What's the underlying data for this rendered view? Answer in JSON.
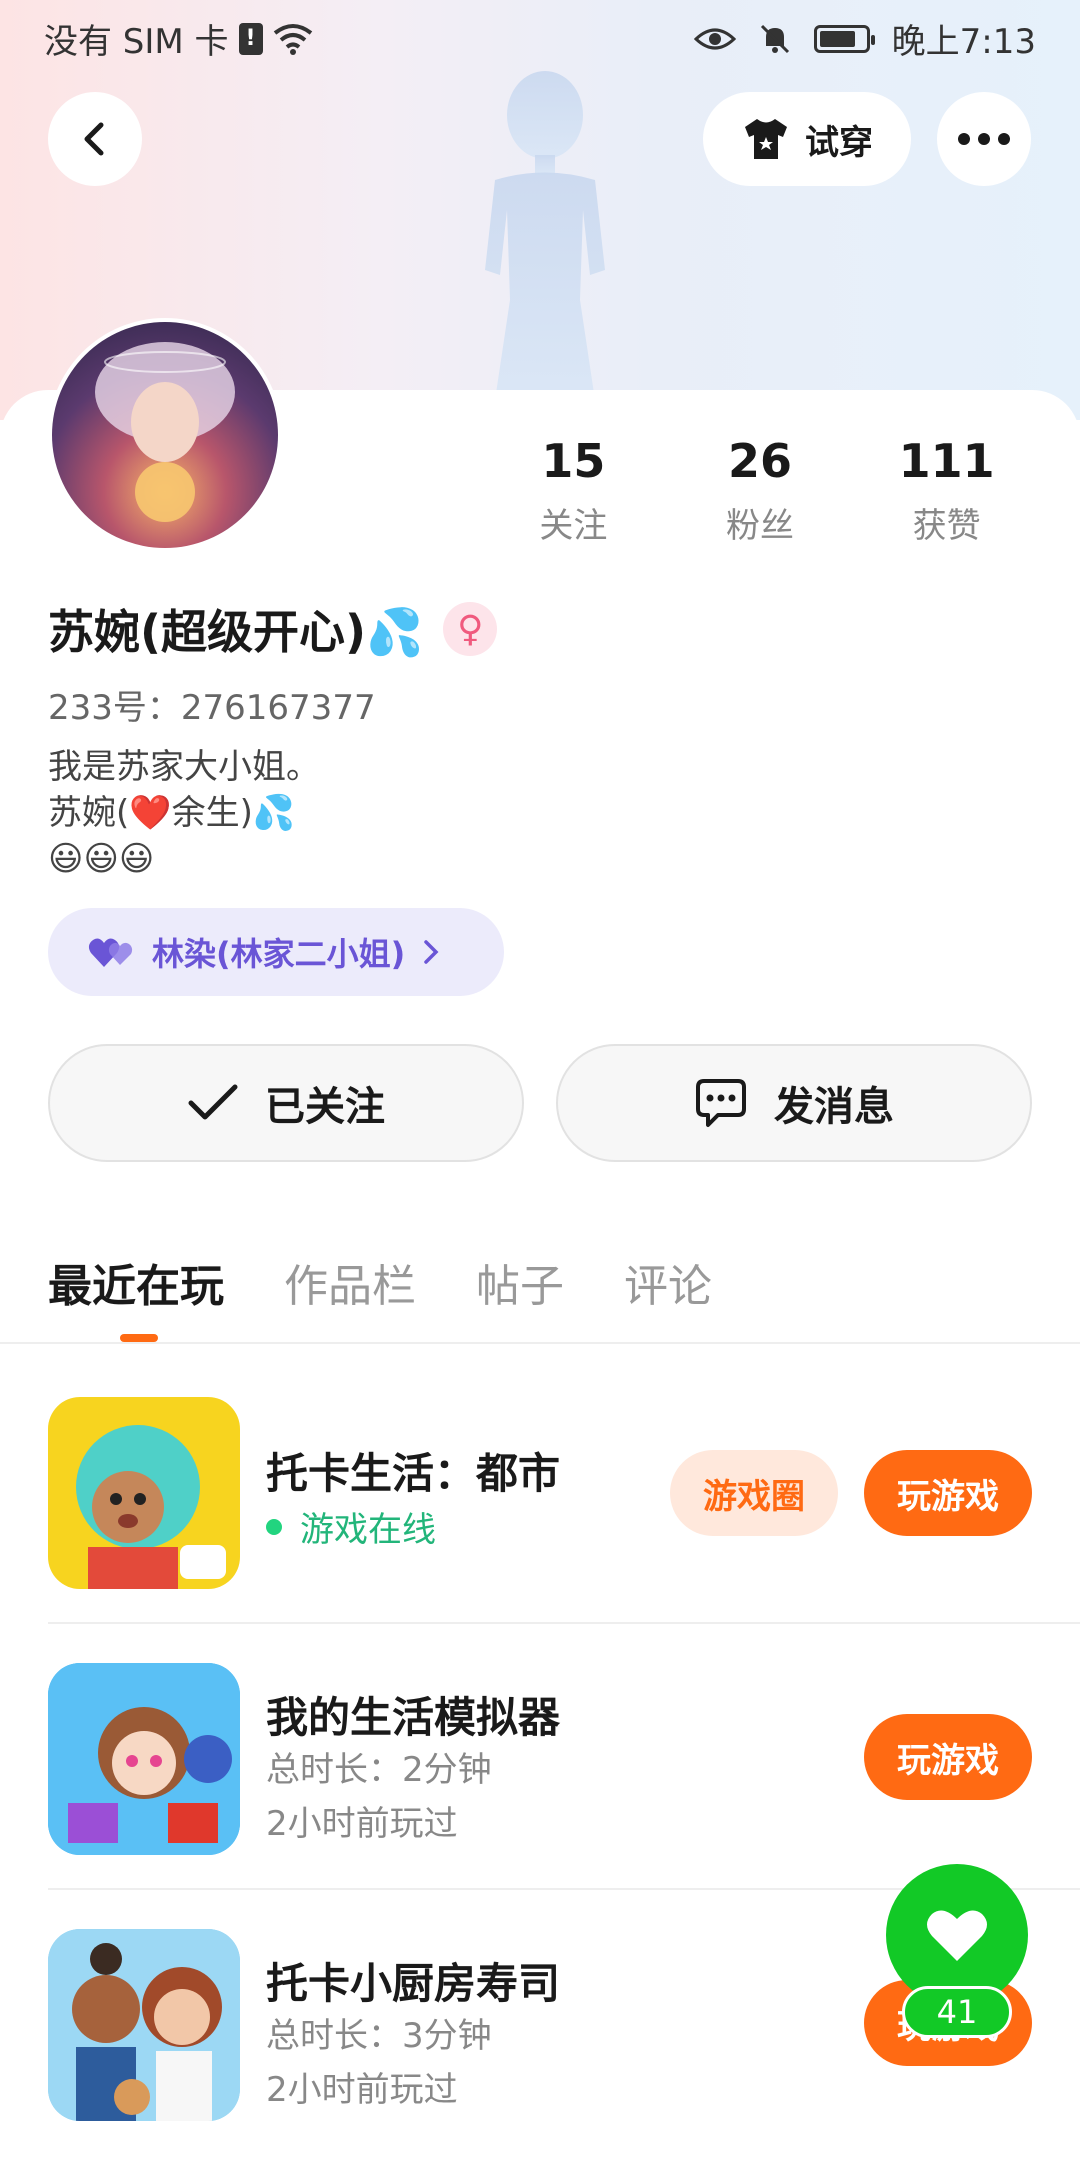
{
  "status_bar": {
    "carrier": "没有 SIM 卡",
    "time": "晚上7:13"
  },
  "header": {
    "try_on_label": "试穿"
  },
  "profile": {
    "stats": [
      {
        "value": "15",
        "label": "关注"
      },
      {
        "value": "26",
        "label": "粉丝"
      },
      {
        "value": "111",
        "label": "获赞"
      }
    ],
    "name": "苏婉(超级开心)💦",
    "gender_symbol": "♀",
    "uid": "233号：276167377",
    "bio_lines": [
      "我是苏家大小姐。",
      "苏婉(❤️余生)💦",
      "😃😃😃"
    ],
    "relation_tag": "林染(林家二小姐)",
    "followed_label": "已关注",
    "message_label": "发消息"
  },
  "tabs": [
    "最近在玩",
    "作品栏",
    "帖子",
    "评论"
  ],
  "games": [
    {
      "title": "托卡生活：都市",
      "status": "游戏在线",
      "circle_label": "游戏圈",
      "play_label": "玩游戏"
    },
    {
      "title": "我的生活模拟器",
      "duration": "总时长：2分钟",
      "last_played": "2小时前玩过",
      "play_label": "玩游戏"
    },
    {
      "title": "托卡小厨房寿司",
      "duration": "总时长：3分钟",
      "last_played": "2小时前玩过",
      "play_label": "玩游戏"
    }
  ],
  "like_fab": {
    "count": "41"
  },
  "colors": {
    "accent": "#ff6a13",
    "online": "#22b57a",
    "like": "#12c926",
    "relation": "#6a55d6"
  }
}
